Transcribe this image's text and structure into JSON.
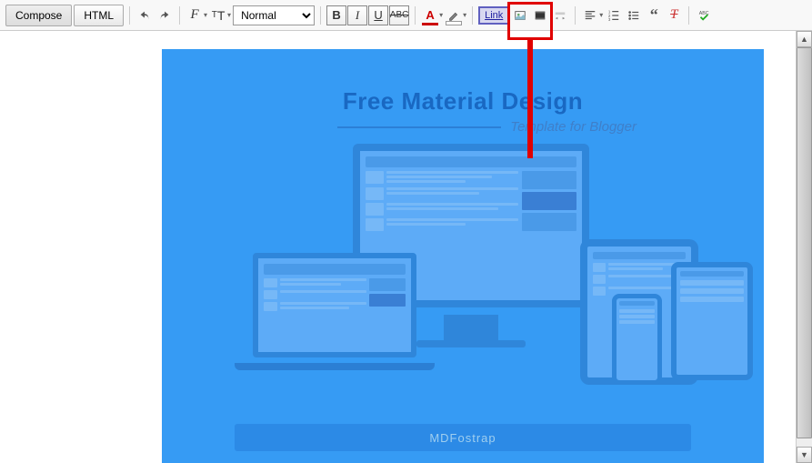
{
  "tabs": {
    "compose": "Compose",
    "html": "HTML"
  },
  "format_select": "Normal",
  "buttons": {
    "bold": "B",
    "italic": "I",
    "underline": "U",
    "strike": "ABC",
    "text_color": "A",
    "link": "Link"
  },
  "content": {
    "title": "Free Material Design",
    "subtitle": "Template for Blogger",
    "footer": "MDFostrap"
  }
}
